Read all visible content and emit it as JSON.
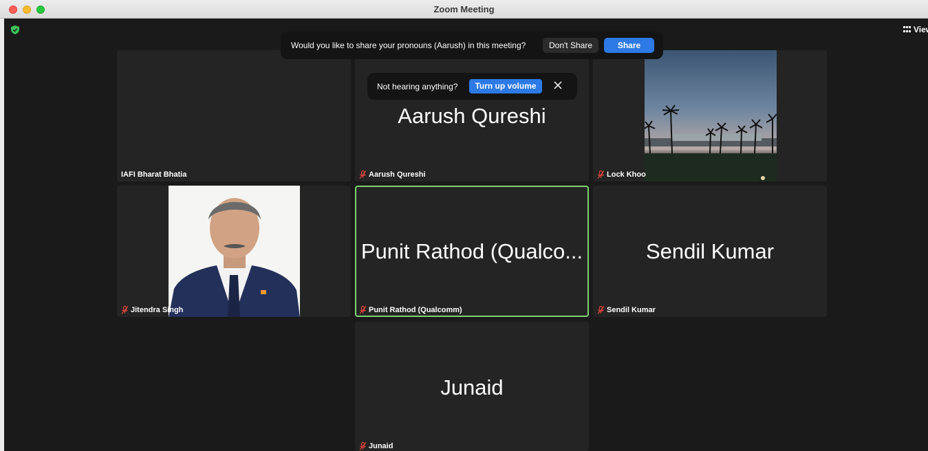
{
  "window": {
    "title": "Zoom Meeting"
  },
  "toolbar": {
    "view_label": "View"
  },
  "pronoun_prompt": {
    "text": "Would you like to share your pronouns (Aarush) in this meeting?",
    "dont_share_label": "Don't Share",
    "share_label": "Share"
  },
  "volume_prompt": {
    "text": "Not hearing anything?",
    "action_label": "Turn up volume"
  },
  "participants": [
    {
      "label": "IAFI Bharat Bhatia",
      "display_name": "",
      "muted": false,
      "video": "off"
    },
    {
      "label": "Aarush Qureshi",
      "display_name": "Aarush Qureshi",
      "muted": true,
      "video": "off"
    },
    {
      "label": "Lock Khoo",
      "display_name": "",
      "muted": true,
      "video": "landscape-photo"
    },
    {
      "label": "Jitendra Singh",
      "display_name": "",
      "muted": true,
      "video": "portrait-photo"
    },
    {
      "label": "Punit Rathod (Qualcomm)",
      "display_name": "Punit Rathod (Qualco...",
      "muted": true,
      "video": "off",
      "active_speaker": true
    },
    {
      "label": "Sendil Kumar",
      "display_name": "Sendil Kumar",
      "muted": true,
      "video": "off"
    },
    {
      "label": "Junaid",
      "display_name": "Junaid",
      "muted": true,
      "video": "off"
    }
  ],
  "colors": {
    "accent": "#2d7ae6",
    "active_border": "#7ed56f",
    "muted_icon": "#e0453b",
    "tile_bg": "#242424"
  }
}
